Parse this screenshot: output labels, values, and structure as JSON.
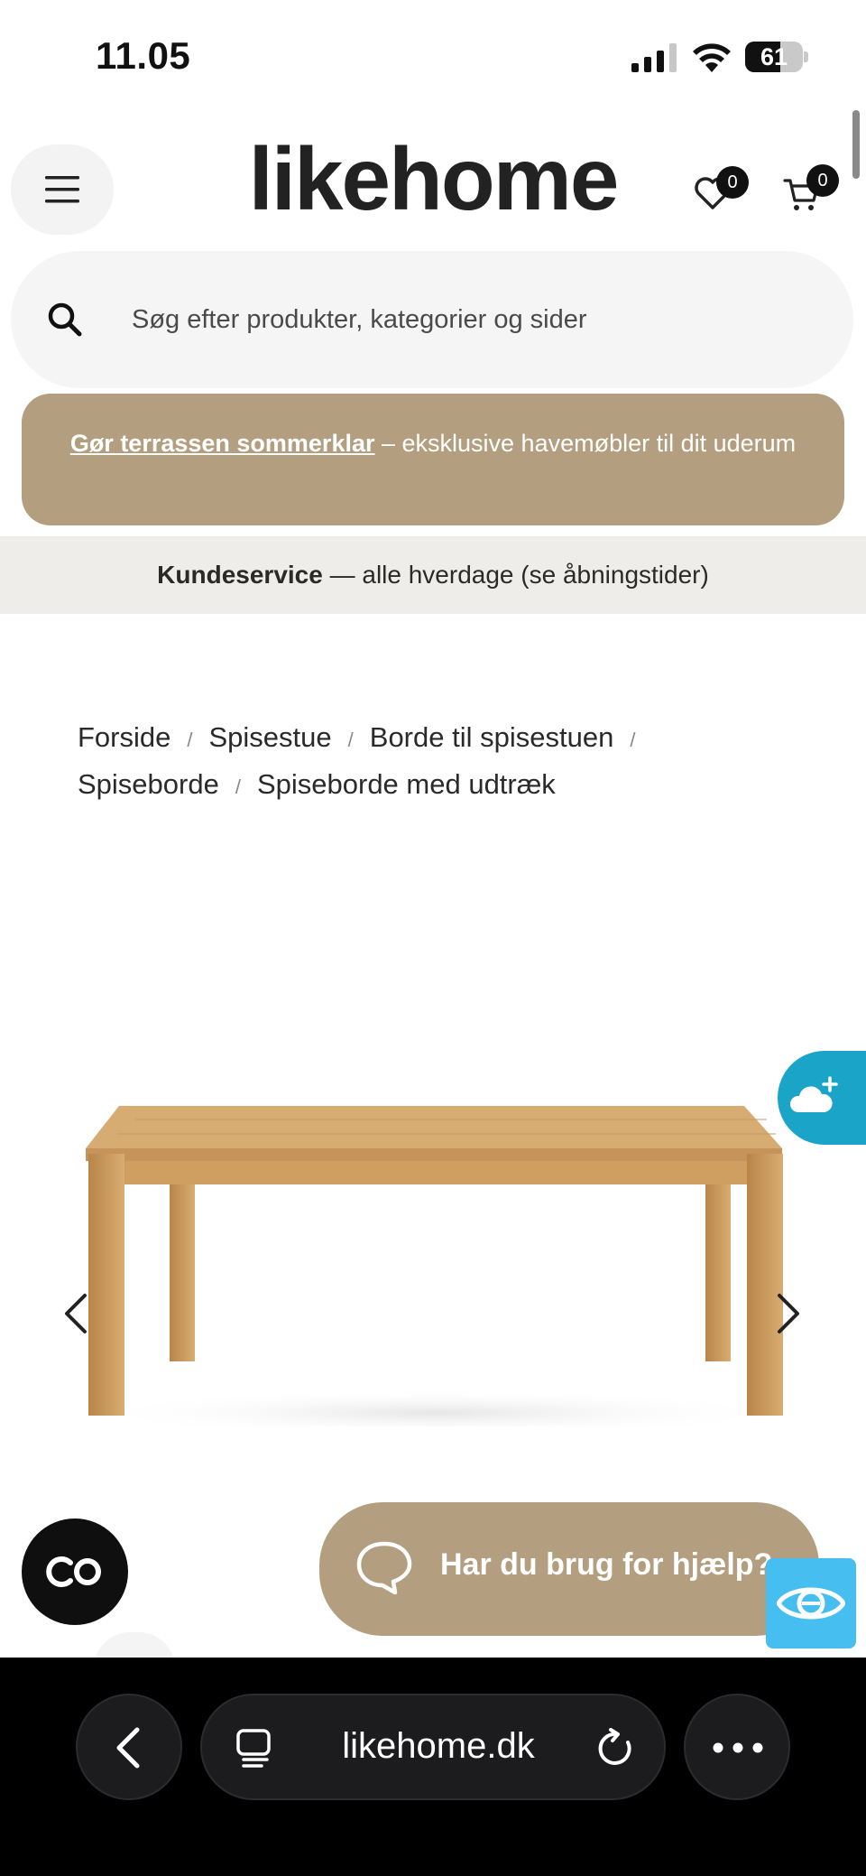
{
  "status_bar": {
    "time": "11.05",
    "battery": "61",
    "battery_level": 0.61
  },
  "header": {
    "logo": "likehome",
    "wishlist_count": "0",
    "cart_count": "0"
  },
  "search": {
    "placeholder": "Søg efter produkter, kategorier og sider"
  },
  "promo": {
    "link_text": "Gør terrassen sommerklar",
    "text": " – eksklusive havemøbler til dit uderum"
  },
  "service": {
    "bold": "Kundeservice",
    "text": " — alle hverdage (se åbningstider)"
  },
  "breadcrumb": [
    "Forside",
    "Spisestue",
    "Borde til spisestuen",
    "Spiseborde",
    "Spiseborde med udtræk"
  ],
  "help": {
    "label": "Har du brug for hjælp?"
  },
  "browser": {
    "url": "likehome.dk"
  },
  "colors": {
    "accent": "#b39f7f",
    "service_bg": "#efedea",
    "weather_btn": "#1aa4c8",
    "a11y_btn": "#46bff0"
  }
}
